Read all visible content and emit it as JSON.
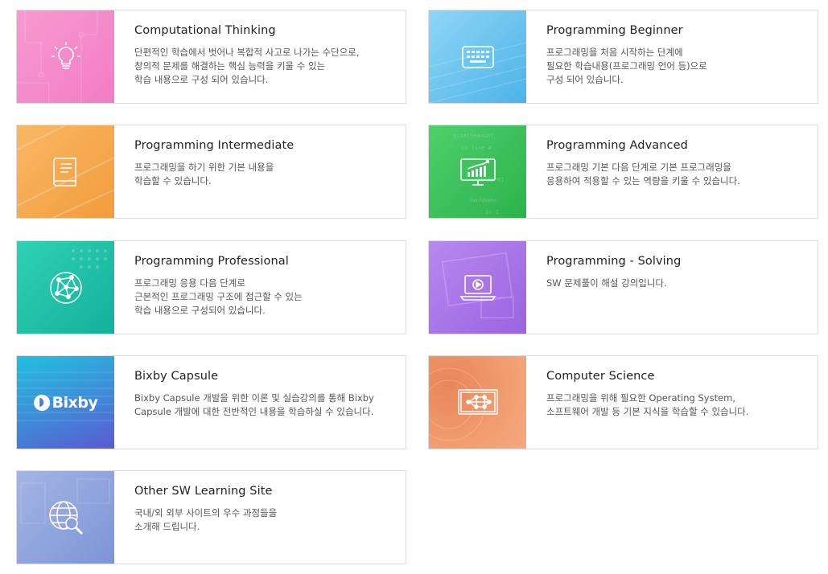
{
  "cards": [
    {
      "title": "Computational Thinking",
      "desc": "단편적인 학습에서 벗어나 복합적 사고로 나가는 수단으로,\n창의적 문제를 해결하는 핵심 능력을 키울 수 있는\n학습 내용으로 구성 되어 있습니다.",
      "icon": "lightbulb-icon",
      "color": "#f484c8"
    },
    {
      "title": "Programming Beginner",
      "desc": "프로그래밍을 처음 시작하는 단계에\n필요한 학습내용(프로그래밍 언어 등)으로\n구성 되어 있습니다.",
      "icon": "keyboard-icon",
      "color": "#6cc7ef"
    },
    {
      "title": "Programming Intermediate",
      "desc": "프로그래밍을 하기 위한 기본 내용을\n학습할 수 있습니다.",
      "icon": "book-icon",
      "color": "#f7a94f"
    },
    {
      "title": "Programming Advanced",
      "desc": "프로그래밍 기본 다음 단계로 기본 프로그래밍을\n응용하여 적용할 수 있는 역량을 키울 수 있습니다.",
      "icon": "chart-monitor-icon",
      "color": "#3cc25c"
    },
    {
      "title": "Programming Professional",
      "desc": "프로그래밍 응용 다음 단계로\n근본적인 프로그래밍 구조에 접근할 수 있는\n학습 내용으로 구성되어 있습니다.",
      "icon": "network-globe-icon",
      "color": "#1cbfa7"
    },
    {
      "title": "Programming - Solving",
      "desc": "SW 문제풀이 해설 강의입니다.",
      "icon": "laptop-play-icon",
      "color": "#a776e6"
    },
    {
      "title": "Bixby Capsule",
      "desc": "Bixby Capsule 개발을 위한 이론 및 실습강의를 통해 Bixby\nCapsule 개발에 대한 전반적인 내용을 학습하실 수 있습니다.",
      "icon": "bixby-logo",
      "logo_text": "Bixby",
      "color": "#2f9ad8"
    },
    {
      "title": "Computer Science",
      "desc": "프로그래밍을 위해 필요한 Operating System,\n소프트웨어 개발 등 기본 지식을 학습할 수 있습니다.",
      "icon": "network-screen-icon",
      "color": "#f09768"
    },
    {
      "title": "Other SW Learning Site",
      "desc": "국내/외 외부 사이트의 우수 과정들을\n소개해 드립니다.",
      "icon": "globe-search-icon",
      "color": "#8fa6dd"
    }
  ]
}
